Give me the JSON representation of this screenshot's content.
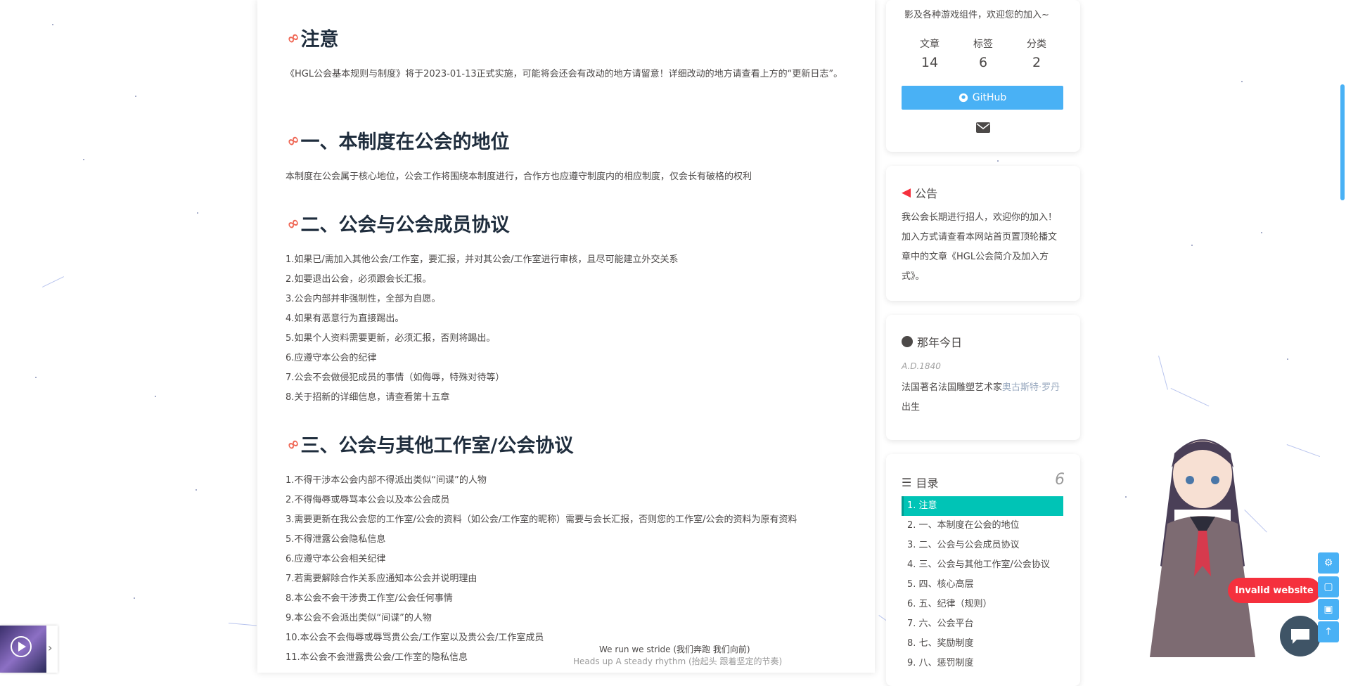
{
  "article": {
    "sections": [
      {
        "title": "注意",
        "para": "《HGL公会基本规则与制度》将于2023-01-13正式实施，可能将会还会有改动的地方请留意！详细改动的地方请查看上方的“更新日志”。"
      },
      {
        "title": "一、本制度在公会的地位",
        "para": "本制度在公会属于核心地位，公会工作将围绕本制度进行，合作方也应遵守制度内的相应制度，仅会长有破格的权利"
      },
      {
        "title": "二、公会与公会成员协议",
        "items": [
          "1.如果已/需加入其他公会/工作室，要汇报，并对其公会/工作室进行审核，且尽可能建立外交关系",
          "2.如要退出公会，必须跟会长汇报。",
          "3.公会内部并非强制性，全部为自愿。",
          "4.如果有恶意行为直接踢出。",
          "5.如果个人资料需要更新，必须汇报，否则将踢出。",
          "6.应遵守本公会的纪律",
          "7.公会不会做侵犯成员的事情（如侮辱，特殊对待等）",
          "8.关于招新的详细信息，请查看第十五章"
        ]
      },
      {
        "title": "三、公会与其他工作室/公会协议",
        "items": [
          "1.不得干涉本公会内部不得派出类似“间谍”的人物",
          "2.不得侮辱或辱骂本公会以及本公会成员",
          "3.需要更新在我公会您的工作室/公会的资料（如公会/工作室的昵称）需要与会长汇报，否则您的工作室/公会的资料为原有资料",
          "5.不得泄露公会隐私信息",
          "6.应遵守本公会相关纪律",
          "7.若需要解除合作关系应通知本公会并说明理由",
          "8.本公会不会干涉贵工作室/公会任何事情",
          "9.本公会不会派出类似“间谍”的人物",
          "10.本公会不会侮辱或辱骂贵公会/工作室以及贵公会/工作室成员",
          "11.本公会不会泄露贵公会/工作室的隐私信息"
        ]
      }
    ]
  },
  "footer": {
    "line1": "We run we stride (我们奔跑 我们向前)",
    "line2": "Heads up A steady rhythm (抬起头 跟着坚定的节奏)"
  },
  "profile": {
    "intro_tail": "影及各种游戏组件，欢迎您的加入~",
    "stats": [
      {
        "label": "文章",
        "value": "14"
      },
      {
        "label": "标签",
        "value": "6"
      },
      {
        "label": "分类",
        "value": "2"
      }
    ],
    "github_label": "GitHub"
  },
  "announcement": {
    "title": "公告",
    "text": "我公会长期进行招人，欢迎你的加入！加入方式请查看本网站首页置顶轮播文章中的文章《HGL公会简介及加入方式》。"
  },
  "history": {
    "title": "那年今日",
    "year": "A.D.1840",
    "text_before": "法国著名法国雕塑艺术家",
    "link": "奥古斯特·罗丹",
    "text_after": "出生"
  },
  "toc": {
    "title": "目录",
    "percent": "6",
    "items": [
      "1. 注意",
      "2. 一、本制度在公会的地位",
      "3. 二、公会与公会成员协议",
      "4. 三、公会与其他工作室/公会协议",
      "5. 四、核心高层",
      "6. 五、纪律（规则）",
      "7. 六、公会平台",
      "8. 七、奖励制度",
      "9. 八、惩罚制度"
    ]
  },
  "widget": {
    "invalid_label": "Invalid website"
  },
  "colors": {
    "accent": "#49b1f5",
    "toc_active": "#00c4b6",
    "anchor": "#ef6654",
    "invalid": "#f5303d"
  }
}
